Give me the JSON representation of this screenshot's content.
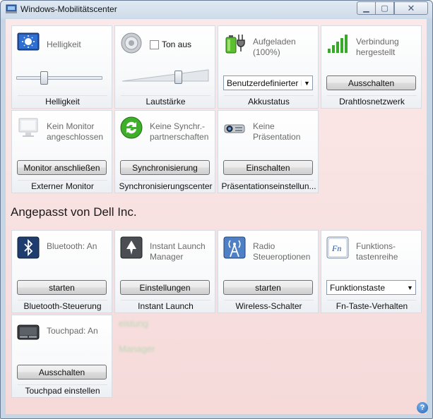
{
  "window": {
    "title": "Windows-Mobilitätscenter"
  },
  "background_ghosts": [
    "eistung",
    "Manager"
  ],
  "section": {
    "title": "Angepasst von Dell Inc."
  },
  "tiles": {
    "brightness": {
      "label": "Helligkeit",
      "name": "Helligkeit",
      "level": 0.3
    },
    "volume": {
      "checkbox_label": "Ton aus",
      "muted": false,
      "name": "Lautstärke",
      "level": 0.65
    },
    "battery": {
      "label": "Aufgeladen (100%)",
      "select_value": "Benutzerdefinierter I",
      "name": "Akkustatus"
    },
    "wireless": {
      "label": "Verbindung hergestellt",
      "button": "Ausschalten",
      "name": "Drahtlosnetzwerk"
    },
    "monitor": {
      "label": "Kein Monitor angeschlossen",
      "button": "Monitor anschließen",
      "name": "Externer Monitor"
    },
    "sync": {
      "label": "Keine Synchr.-partnerschaften",
      "button": "Synchronisierung",
      "name": "Synchronisierungscenter"
    },
    "presentation": {
      "label": "Keine Präsentation",
      "button": "Einschalten",
      "name": "Präsentationseinstellun..."
    },
    "bluetooth": {
      "label": "Bluetooth: An",
      "button": "starten",
      "name": "Bluetooth-Steuerung"
    },
    "instant_launch": {
      "label": "Instant Launch Manager",
      "button": "Einstellungen",
      "name": "Instant Launch"
    },
    "radio": {
      "label": "Radio Steueroptionen",
      "button": "starten",
      "name": "Wireless-Schalter"
    },
    "fn": {
      "label": "Funktions-tastenreihe",
      "select_value": "Funktionstaste",
      "name": "Fn-Taste-Verhalten"
    },
    "touchpad": {
      "label": "Touchpad: An",
      "button": "Ausschalten",
      "name": "Touchpad einstellen"
    }
  },
  "help": {
    "label": "?"
  }
}
